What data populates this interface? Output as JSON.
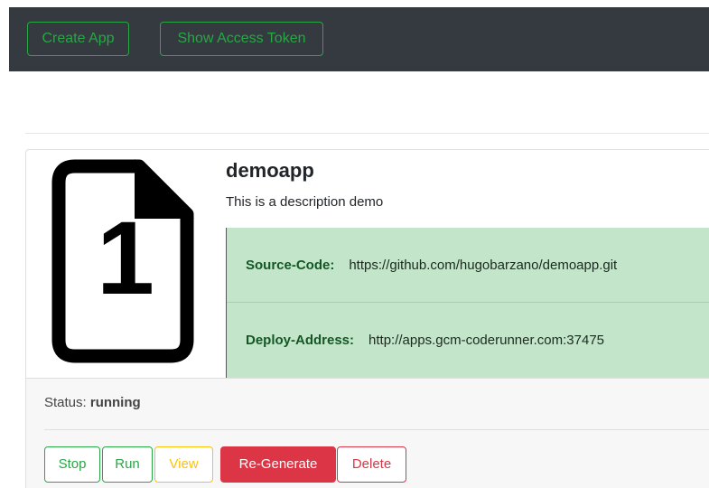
{
  "navbar": {
    "create_app_label": "Create App",
    "show_token_label": "Show Access Token"
  },
  "app": {
    "icon_number": "1",
    "name": "demoapp",
    "description": "This is a description demo",
    "source_code_label": "Source-Code:",
    "source_code_value": "https://github.com/hugobarzano/demoapp.git",
    "deploy_address_label": "Deploy-Address:",
    "deploy_address_value": "http://apps.gcm-coderunner.com:37475",
    "status_label": "Status:",
    "status_value": "running"
  },
  "actions": {
    "stop_label": "Stop",
    "run_label": "Run",
    "view_label": "View",
    "regenerate_label": "Re-Generate",
    "delete_label": "Delete"
  },
  "colors": {
    "navbar_bg": "#343a40",
    "success": "#28a745",
    "warning": "#ffc107",
    "danger": "#dc3545",
    "info_box_bg": "#c3e6cb"
  }
}
